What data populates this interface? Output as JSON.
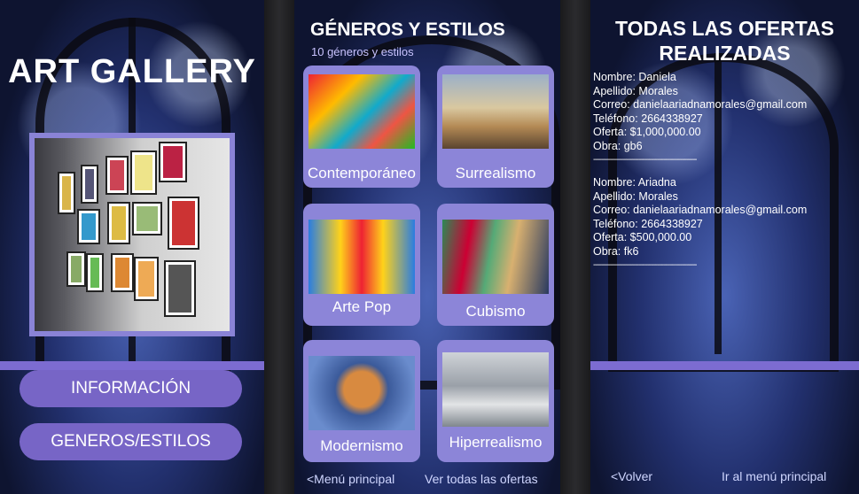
{
  "screen1": {
    "title": "ART GALLERY",
    "buttons": [
      "INFORMACIÓN",
      "GENEROS/ESTILOS"
    ]
  },
  "screen2": {
    "title": "GÉNEROS Y ESTILOS",
    "subtitle": "10 géneros y estilos",
    "cards": [
      {
        "label": "Contemporáneo"
      },
      {
        "label": "Surrealismo"
      },
      {
        "label": "Arte Pop"
      },
      {
        "label": "Cubismo"
      },
      {
        "label": "Modernismo"
      },
      {
        "label": "Hiperrealismo"
      }
    ],
    "link_back": "<Menú principal",
    "link_offers": "Ver todas las ofertas"
  },
  "screen3": {
    "title_line1": "TODAS LAS OFERTAS",
    "title_line2": "REALIZADAS",
    "offers": [
      {
        "nombre": "Nombre: Daniela",
        "apellido": "Apellido: Morales",
        "correo": "Correo: danielaariadnamorales@gmail.com",
        "telefono": "Teléfono: 2664338927",
        "oferta": "Oferta: $1,000,000.00",
        "obra": "Obra: gb6"
      },
      {
        "nombre": "Nombre: Ariadna",
        "apellido": "Apellido: Morales",
        "correo": "Correo: danielaariadnamorales@gmail.com",
        "telefono": "Teléfono: 2664338927",
        "oferta": "Oferta: $500,000.00",
        "obra": "Obra: fk6"
      }
    ],
    "separator": "--------------------------------------------------",
    "link_back": "<Volver",
    "link_menu": "Ir al menú principal"
  }
}
